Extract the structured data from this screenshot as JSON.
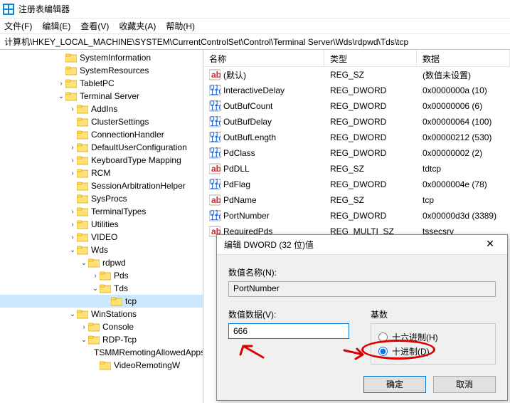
{
  "app": {
    "title": "注册表编辑器"
  },
  "menu": {
    "file": "文件(F)",
    "edit": "编辑(E)",
    "view": "查看(V)",
    "fav": "收藏夹(A)",
    "help": "帮助(H)"
  },
  "path": "计算机\\HKEY_LOCAL_MACHINE\\SYSTEM\\CurrentControlSet\\Control\\Terminal Server\\Wds\\rdpwd\\Tds\\tcp",
  "tree": [
    {
      "depth": 5,
      "expand": "",
      "label": "SystemInformation"
    },
    {
      "depth": 5,
      "expand": "",
      "label": "SystemResources"
    },
    {
      "depth": 5,
      "expand": ">",
      "label": "TabletPC"
    },
    {
      "depth": 5,
      "expand": "v",
      "label": "Terminal Server"
    },
    {
      "depth": 6,
      "expand": ">",
      "label": "AddIns"
    },
    {
      "depth": 6,
      "expand": "",
      "label": "ClusterSettings"
    },
    {
      "depth": 6,
      "expand": "",
      "label": "ConnectionHandler"
    },
    {
      "depth": 6,
      "expand": ">",
      "label": "DefaultUserConfiguration"
    },
    {
      "depth": 6,
      "expand": ">",
      "label": "KeyboardType Mapping"
    },
    {
      "depth": 6,
      "expand": ">",
      "label": "RCM"
    },
    {
      "depth": 6,
      "expand": "",
      "label": "SessionArbitrationHelper"
    },
    {
      "depth": 6,
      "expand": "",
      "label": "SysProcs"
    },
    {
      "depth": 6,
      "expand": ">",
      "label": "TerminalTypes"
    },
    {
      "depth": 6,
      "expand": ">",
      "label": "Utilities"
    },
    {
      "depth": 6,
      "expand": ">",
      "label": "VIDEO"
    },
    {
      "depth": 6,
      "expand": "v",
      "label": "Wds"
    },
    {
      "depth": 7,
      "expand": "v",
      "label": "rdpwd"
    },
    {
      "depth": 8,
      "expand": ">",
      "label": "Pds"
    },
    {
      "depth": 8,
      "expand": "v",
      "label": "Tds"
    },
    {
      "depth": 9,
      "expand": "",
      "label": "tcp",
      "selected": true
    },
    {
      "depth": 6,
      "expand": "v",
      "label": "WinStations"
    },
    {
      "depth": 7,
      "expand": ">",
      "label": "Console"
    },
    {
      "depth": 7,
      "expand": "v",
      "label": "RDP-Tcp"
    },
    {
      "depth": 8,
      "expand": "",
      "label": "TSMMRemotingAllowedApps"
    },
    {
      "depth": 8,
      "expand": "",
      "label": "VideoRemotingW"
    }
  ],
  "columns": {
    "name": "名称",
    "type": "类型",
    "data": "数据"
  },
  "values": [
    {
      "icon": "str",
      "name": "(默认)",
      "type": "REG_SZ",
      "data": "(数值未设置)"
    },
    {
      "icon": "bin",
      "name": "InteractiveDelay",
      "type": "REG_DWORD",
      "data": "0x0000000a (10)"
    },
    {
      "icon": "bin",
      "name": "OutBufCount",
      "type": "REG_DWORD",
      "data": "0x00000006 (6)"
    },
    {
      "icon": "bin",
      "name": "OutBufDelay",
      "type": "REG_DWORD",
      "data": "0x00000064 (100)"
    },
    {
      "icon": "bin",
      "name": "OutBufLength",
      "type": "REG_DWORD",
      "data": "0x00000212 (530)"
    },
    {
      "icon": "bin",
      "name": "PdClass",
      "type": "REG_DWORD",
      "data": "0x00000002 (2)"
    },
    {
      "icon": "str",
      "name": "PdDLL",
      "type": "REG_SZ",
      "data": "tdtcp"
    },
    {
      "icon": "bin",
      "name": "PdFlag",
      "type": "REG_DWORD",
      "data": "0x0000004e (78)"
    },
    {
      "icon": "str",
      "name": "PdName",
      "type": "REG_SZ",
      "data": "tcp"
    },
    {
      "icon": "bin",
      "name": "PortNumber",
      "type": "REG_DWORD",
      "data": "0x00000d3d (3389)"
    },
    {
      "icon": "str",
      "name": "RequiredPds",
      "type": "REG_MULTI_SZ",
      "data": "tssecsrv"
    }
  ],
  "dialog": {
    "title": "编辑 DWORD (32 位)值",
    "name_label": "数值名称(N):",
    "name_value": "PortNumber",
    "data_label": "数值数据(V):",
    "data_value": "666",
    "base_label": "基数",
    "hex_label": "十六进制(H)",
    "dec_label": "十进制(D)",
    "ok": "确定",
    "cancel": "取消"
  }
}
